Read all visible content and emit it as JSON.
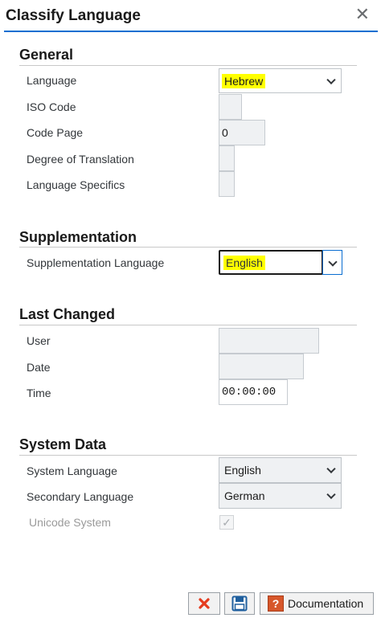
{
  "dialog": {
    "title": "Classify Language",
    "close_glyph": "✕"
  },
  "general": {
    "heading": "General",
    "language_label": "Language",
    "language_value": "Hebrew",
    "iso_code_label": "ISO Code",
    "iso_code_value": "",
    "code_page_label": "Code Page",
    "code_page_value": "0",
    "degree_label": "Degree of Translation",
    "degree_value": "",
    "specifics_label": "Language Specifics",
    "specifics_value": ""
  },
  "supplementation": {
    "heading": "Supplementation",
    "language_label": "Supplementation Language",
    "language_value": "English"
  },
  "last_changed": {
    "heading": "Last Changed",
    "user_label": "User",
    "user_value": "",
    "date_label": "Date",
    "date_value": "",
    "time_label": "Time",
    "time_value": "00:00:00"
  },
  "system_data": {
    "heading": "System Data",
    "system_language_label": "System Language",
    "system_language_value": "English",
    "secondary_language_label": "Secondary Language",
    "secondary_language_value": "German",
    "unicode_label": "Unicode System",
    "unicode_checked": true
  },
  "footer": {
    "documentation_label": "Documentation"
  },
  "colors": {
    "accent": "#0a6ed1",
    "highlight": "#ffff00",
    "cancel_red": "#e53b1e",
    "doc_orange": "#d7572b"
  },
  "icons": [
    "close-icon",
    "chevron-down-icon",
    "checkmark-icon",
    "cancel-x-icon",
    "floppy-disk-save-icon",
    "question-help-icon"
  ]
}
